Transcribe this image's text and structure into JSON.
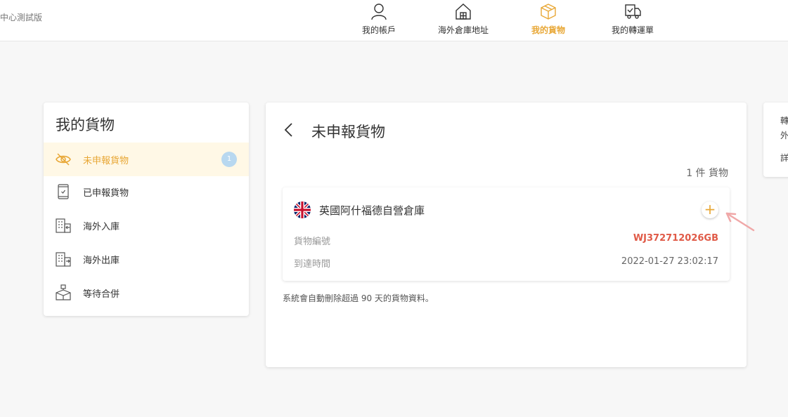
{
  "header": {
    "brand": "中心測試版",
    "nav": [
      {
        "label": "我的帳戶",
        "icon": "user-icon",
        "active": false
      },
      {
        "label": "海外倉庫地址",
        "icon": "warehouse-icon",
        "active": false
      },
      {
        "label": "我的貨物",
        "icon": "package-icon",
        "active": true
      },
      {
        "label": "我的轉運單",
        "icon": "delivery-truck-icon",
        "active": false
      }
    ]
  },
  "sidebar": {
    "title": "我的貨物",
    "items": [
      {
        "label": "未申報貨物",
        "icon": "eye-off-icon",
        "badge": "1",
        "active": true
      },
      {
        "label": "已申報貨物",
        "icon": "phone-check-icon",
        "active": false
      },
      {
        "label": "海外入庫",
        "icon": "building-in-icon",
        "active": false
      },
      {
        "label": "海外出庫",
        "icon": "building-out-icon",
        "active": false
      },
      {
        "label": "等待合併",
        "icon": "merge-box-icon",
        "active": false
      }
    ]
  },
  "main": {
    "title": "未申報貨物",
    "count_label": "1 件 貨物",
    "items": [
      {
        "warehouse": "英國阿什福德自營倉庫",
        "flag": "uk-flag-icon",
        "tracking_label": "貨物編號",
        "tracking_no": "WJ372712026GB",
        "arrival_label": "到達時間",
        "arrival_time": "2022-01-27 23:02:17"
      }
    ],
    "note": "系統會自動刪除超過 90 天的貨物資料。"
  },
  "right_panel": {
    "line1": "轉",
    "line2": "外",
    "line3": "詳"
  },
  "colors": {
    "accent": "#e8a735",
    "tracking": "#e05a47",
    "badge": "#b8d8f0",
    "active_bg": "#fff8e6"
  }
}
